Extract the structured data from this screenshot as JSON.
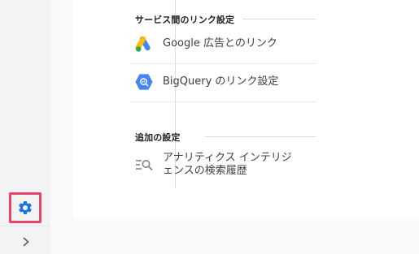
{
  "sections": {
    "service_links": {
      "header": "サービス間のリンク設定",
      "items": [
        {
          "label": "Google 広告とのリンク",
          "icon": "google-ads-icon"
        },
        {
          "label": "BigQuery のリンク設定",
          "icon": "bigquery-icon"
        }
      ]
    },
    "additional": {
      "header": "追加の設定",
      "items": [
        {
          "label_line1": "アナリティクス インテリジ",
          "label_line2": "ェンスの検索履歴",
          "icon": "search-history-icon"
        }
      ]
    }
  },
  "rail": {
    "settings_icon": "gear-icon",
    "expand_icon": "chevron-right-icon"
  },
  "colors": {
    "highlight": "#e8436c",
    "gear": "#1a73e8",
    "ads_blue": "#4285f4",
    "ads_yellow": "#fbbc04",
    "ads_green": "#34a853",
    "bigquery": "#4285f4"
  }
}
